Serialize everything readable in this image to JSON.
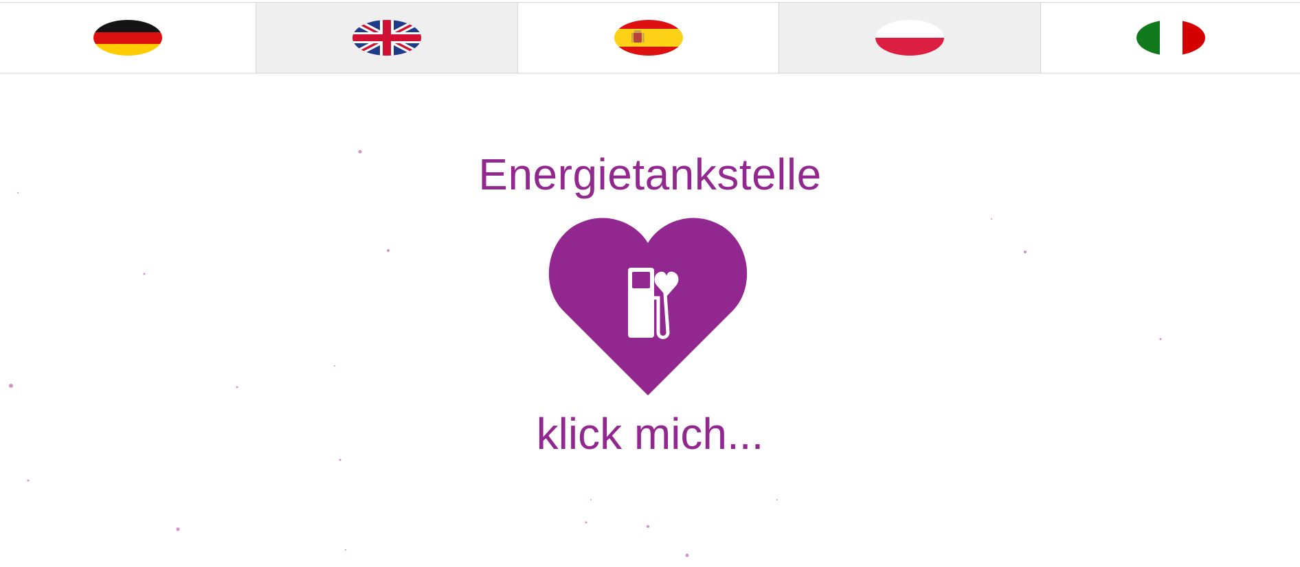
{
  "languages": [
    {
      "code": "de",
      "flag": "germany-flag"
    },
    {
      "code": "en",
      "flag": "united-kingdom-flag"
    },
    {
      "code": "es",
      "flag": "spain-flag"
    },
    {
      "code": "pl",
      "flag": "poland-flag"
    },
    {
      "code": "it",
      "flag": "italy-flag"
    }
  ],
  "main": {
    "title": "Energietankstelle",
    "cta_label": "klick mich...",
    "icon": "heart-fuel-pump-icon"
  },
  "colors": {
    "accent": "#92278f",
    "particles": "#d78fc9"
  }
}
